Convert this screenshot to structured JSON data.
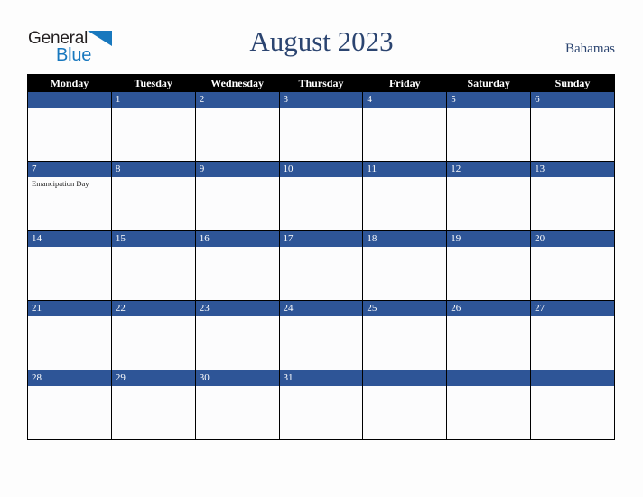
{
  "brand": {
    "name_part1": "General",
    "name_part2": "Blue"
  },
  "header": {
    "title": "August 2023",
    "country": "Bahamas"
  },
  "calendar": {
    "weekday_headers": [
      "Monday",
      "Tuesday",
      "Wednesday",
      "Thursday",
      "Friday",
      "Saturday",
      "Sunday"
    ],
    "colors": {
      "header_background": "#000000",
      "header_text": "#ffffff",
      "date_bar": "#2e5597",
      "date_text": "#ffffff",
      "cell_background": "#fcfcfd",
      "border": "#000000",
      "title_text": "#2b4470",
      "logo_blue": "#1878be",
      "page_background": "#fdfdfd"
    },
    "weeks": [
      [
        {
          "day": "",
          "events": []
        },
        {
          "day": "1",
          "events": []
        },
        {
          "day": "2",
          "events": []
        },
        {
          "day": "3",
          "events": []
        },
        {
          "day": "4",
          "events": []
        },
        {
          "day": "5",
          "events": []
        },
        {
          "day": "6",
          "events": []
        }
      ],
      [
        {
          "day": "7",
          "events": [
            "Emancipation Day"
          ]
        },
        {
          "day": "8",
          "events": []
        },
        {
          "day": "9",
          "events": []
        },
        {
          "day": "10",
          "events": []
        },
        {
          "day": "11",
          "events": []
        },
        {
          "day": "12",
          "events": []
        },
        {
          "day": "13",
          "events": []
        }
      ],
      [
        {
          "day": "14",
          "events": []
        },
        {
          "day": "15",
          "events": []
        },
        {
          "day": "16",
          "events": []
        },
        {
          "day": "17",
          "events": []
        },
        {
          "day": "18",
          "events": []
        },
        {
          "day": "19",
          "events": []
        },
        {
          "day": "20",
          "events": []
        }
      ],
      [
        {
          "day": "21",
          "events": []
        },
        {
          "day": "22",
          "events": []
        },
        {
          "day": "23",
          "events": []
        },
        {
          "day": "24",
          "events": []
        },
        {
          "day": "25",
          "events": []
        },
        {
          "day": "26",
          "events": []
        },
        {
          "day": "27",
          "events": []
        }
      ],
      [
        {
          "day": "28",
          "events": []
        },
        {
          "day": "29",
          "events": []
        },
        {
          "day": "30",
          "events": []
        },
        {
          "day": "31",
          "events": []
        },
        {
          "day": "",
          "events": []
        },
        {
          "day": "",
          "events": []
        },
        {
          "day": "",
          "events": []
        }
      ]
    ]
  }
}
